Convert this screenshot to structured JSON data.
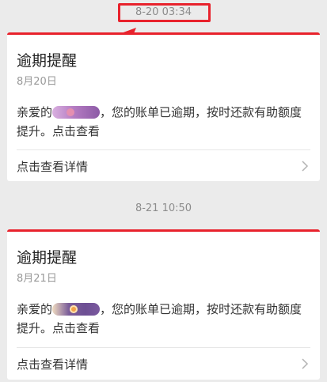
{
  "conversation": {
    "messages": [
      {
        "timestamp": "8-20 03:34",
        "title": "逾期提醒",
        "date": "8月20日",
        "body_prefix": "亲爱的",
        "body_suffix": "，您的账单已逾期，按时还款有助额度提升。点击查看",
        "detail_label": "点击查看详情",
        "highlighted": true
      },
      {
        "timestamp": "8-21 10:50",
        "title": "逾期提醒",
        "date": "8月21日",
        "body_prefix": "亲爱的",
        "body_suffix": "，您的账单已逾期，按时还款有助额度提升。点击查看",
        "detail_label": "点击查看详情",
        "highlighted": false
      }
    ]
  },
  "colors": {
    "background": "#ebebeb",
    "accent_red": "#e8222c",
    "card": "#ffffff"
  },
  "icons": {
    "chevron": "chevron-right-icon"
  }
}
